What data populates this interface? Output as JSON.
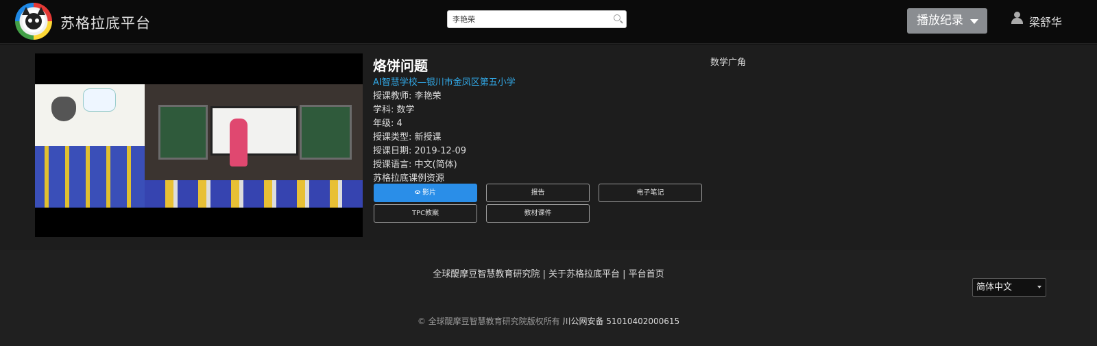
{
  "header": {
    "brand": "苏格拉底平台",
    "search_value": "李艳荣",
    "play_record_label": "播放纪录",
    "username": "梁舒华"
  },
  "lesson": {
    "title": "烙饼问题",
    "school": "AI智慧学校—银川市金凤区第五小学",
    "teacher": "授课教师: 李艳荣",
    "subject": "学科: 数学",
    "grade": "年级: 4",
    "type": "授课类型: 新授课",
    "date": "授课日期: 2019-12-09",
    "language": "授课语言: 中文(简体)",
    "resource": "苏格拉底课例资源",
    "category": "数学广角"
  },
  "resources": {
    "film": "影片",
    "report": "报告",
    "notes": "电子笔记",
    "tpc": "TPC教案",
    "courseware": "教材课件"
  },
  "footer": {
    "link_institute": "全球醍摩豆智慧教育研究院",
    "separator": " | ",
    "link_about": "关于苏格拉底平台",
    "link_home": "平台首页",
    "language": "简体中文",
    "copyright": "© 全球醍摩豆智慧教育研究院版权所有",
    "icp": "川公网安备 51010402000615"
  },
  "colors": {
    "accent_blue": "#2a8ee8",
    "link_blue": "#31a8e6",
    "nav_bg": "#0b0b0b",
    "main_bg": "#1d1d1d",
    "footer_bg": "#202020"
  }
}
